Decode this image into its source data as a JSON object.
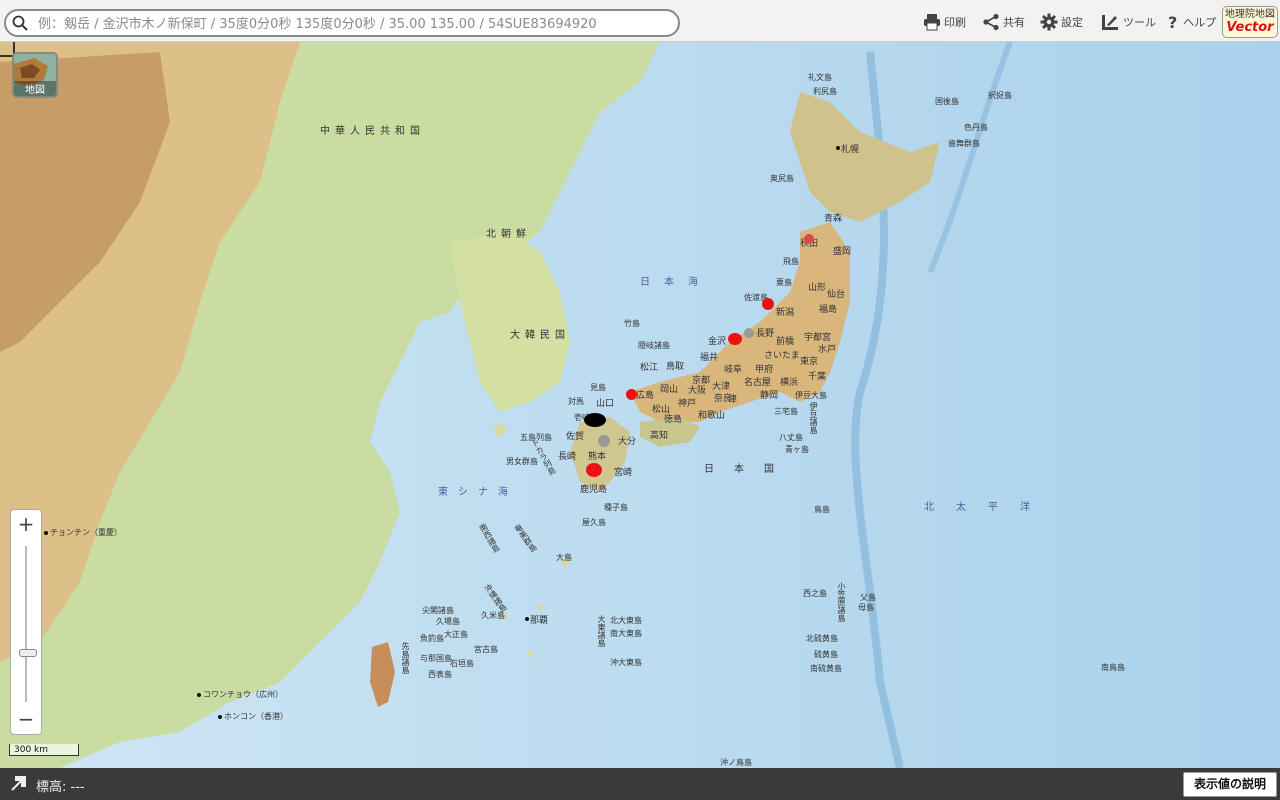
{
  "search": {
    "placeholder": "例：剱岳 / 金沢市木ノ新保町 / 35度0分0秒 135度0分0秒 / 35.00 135.00 / 54SUE83694920",
    "icon": "search-icon"
  },
  "toolbar": {
    "print": "印刷",
    "share": "共有",
    "settings": "設定",
    "tools": "ツール",
    "help": "ヘルプ",
    "logo_line1": "地理院地図",
    "logo_line2": "Vector"
  },
  "map_type_button": {
    "label": "地図"
  },
  "zoom": {
    "in": "+",
    "out": "−",
    "level_fraction": 0.32
  },
  "scale_bar": "300 km",
  "status": {
    "elevation": "標高: ---",
    "explain_button": "表示値の説明"
  },
  "labels": {
    "regions": [
      "中華人民共和国",
      "北朝鮮",
      "大韓民国",
      "日本国"
    ],
    "seas": [
      "日本海",
      "東シナ海",
      "北太平洋"
    ],
    "cities": [
      "札幌",
      "青森",
      "秋田",
      "盛岡",
      "山形",
      "仙台",
      "福島",
      "新潟",
      "金沢",
      "長野",
      "前橋",
      "宇都宮",
      "水戸",
      "さいたま",
      "東京",
      "千葉",
      "甲府",
      "岐阜",
      "名古屋",
      "横浜",
      "静岡",
      "福井",
      "京都",
      "大津",
      "大阪",
      "神戸",
      "奈良",
      "和歌山",
      "津",
      "鳥取",
      "松江",
      "岡山",
      "広島",
      "山口",
      "徳島",
      "高知",
      "松山",
      "大分",
      "佐賀",
      "長崎",
      "熊本",
      "宮崎",
      "鹿児島",
      "那覇"
    ],
    "islands": [
      "礼文島",
      "利尻島",
      "奥尻島",
      "国後島",
      "択捉島",
      "色丹島",
      "歯舞群島",
      "飛島",
      "粟島",
      "佐渡島",
      "竹島",
      "隠岐諸島",
      "見島",
      "対馬",
      "壱岐",
      "男女群島",
      "五島列島",
      "種子島",
      "屋久島",
      "大島",
      "伊豆大島",
      "三宅島",
      "八丈島",
      "青ヶ島",
      "鳥島",
      "西之島",
      "父島",
      "母島",
      "北硫黄島",
      "硫黄島",
      "南硫黄島",
      "南鳥島",
      "北大東島",
      "南大東島",
      "沖大東島",
      "久米島",
      "大正島",
      "魚釣島",
      "与那国島",
      "石垣島",
      "西表島",
      "宮古島",
      "沖ノ鳥島",
      "尖閣諸島",
      "久場島",
      "伊豆諸島",
      "小笠原諸島",
      "大東諸島",
      "南西諸島",
      "トカラ列島",
      "奄美群島",
      "沖縄諸島",
      "先島諸島"
    ],
    "foreign_cities": [
      "チョンチン（重慶）",
      "コワンチョウ（広州）",
      "ホンコン（香港）"
    ]
  },
  "colors": {
    "sea": "#b7d9ee",
    "deep_sea": "#7fb6da",
    "lowland": "#c7dca0",
    "highland": "#d7b47e",
    "mountain": "#b5845a",
    "marker_red": "#ee1111",
    "marker_black": "#000000",
    "marker_gray": "#999999"
  }
}
